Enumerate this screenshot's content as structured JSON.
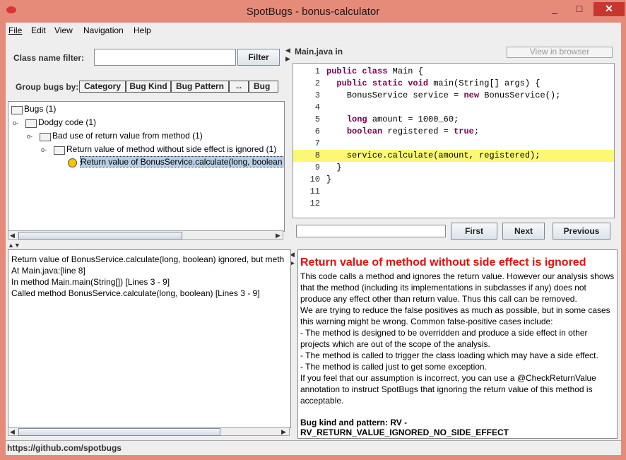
{
  "window": {
    "title": "SpotBugs - bonus-calculator",
    "controls": {
      "minimize": "_",
      "maximize": "□",
      "close": "✕"
    }
  },
  "menu": {
    "items": [
      "File",
      "Edit",
      "View",
      "Navigation",
      "Help"
    ],
    "mnemonics": [
      "F",
      "E",
      "",
      "",
      ""
    ]
  },
  "filter": {
    "label": "Class name filter:",
    "value": "",
    "button": "Filter"
  },
  "group_by": {
    "label": "Group bugs by:",
    "tabs": [
      "Category",
      "Bug Kind",
      "Bug Pattern",
      "↔",
      "Bug R"
    ]
  },
  "tree": {
    "nodes": [
      {
        "label": "Bugs (1)"
      },
      {
        "label": "Dodgy code (1)"
      },
      {
        "label": "Bad use of return value from method (1)"
      },
      {
        "label": "Return value of method without side effect is ignored (1)"
      },
      {
        "label": "Return value of BonusService.calculate(long, boolean"
      }
    ]
  },
  "source": {
    "header": "Main.java in",
    "view_in_browser": "View in browser",
    "lines": [
      {
        "n": "1",
        "text": "public class Main {"
      },
      {
        "n": "2",
        "text": "  public static void main(String[] args) {"
      },
      {
        "n": "3",
        "text": "    BonusService service = new BonusService();"
      },
      {
        "n": "4",
        "text": ""
      },
      {
        "n": "5",
        "text": "    long amount = 1000_60;"
      },
      {
        "n": "6",
        "text": "    boolean registered = true;"
      },
      {
        "n": "7",
        "text": ""
      },
      {
        "n": "8",
        "text": "    service.calculate(amount, registered);"
      },
      {
        "n": "9",
        "text": "  }"
      },
      {
        "n": "10",
        "text": "}"
      },
      {
        "n": "11",
        "text": ""
      },
      {
        "n": "12",
        "text": ""
      }
    ],
    "highlighted_line": "8",
    "find": {
      "value": "",
      "first": "First",
      "next": "Next",
      "previous": "Previous"
    }
  },
  "summary": {
    "lines": [
      "Return value of BonusService.calculate(long, boolean) ignored, but meth",
      "At Main.java:[line 8]",
      "In method Main.main(String[]) [Lines 3 - 9]",
      "Called method BonusService.calculate(long, boolean) [Lines 3 - 9]"
    ]
  },
  "details": {
    "title": "Return value of method without side effect is ignored",
    "paragraphs": [
      "This code calls a method and ignores the return value. However our analysis shows that the method (including its implementations in subclasses if any) does not produce any effect other than return value. Thus this call can be removed.",
      "We are trying to reduce the false positives as much as possible, but in some cases this warning might be wrong. Common false-positive cases include:",
      "- The method is designed to be overridden and produce a side effect in other projects which are out of the scope of the analysis.",
      "- The method is called to trigger the class loading which may have a side effect.",
      "- The method is called just to get some exception.",
      "If you feel that our assumption is incorrect, you can use a @CheckReturnValue annotation to instruct SpotBugs that ignoring the return value of this method is acceptable."
    ],
    "footer": "Bug kind and pattern: RV - RV_RETURN_VALUE_IGNORED_NO_SIDE_EFFECT"
  },
  "status": {
    "text": "https://github.com/spotbugs"
  },
  "colors": {
    "highlight": "#fcf874",
    "title_red": "#e01010",
    "window_frame": "#e68a7a"
  },
  "icons": [
    "folder-icon",
    "bug-icon",
    "expand-handle-icon"
  ]
}
